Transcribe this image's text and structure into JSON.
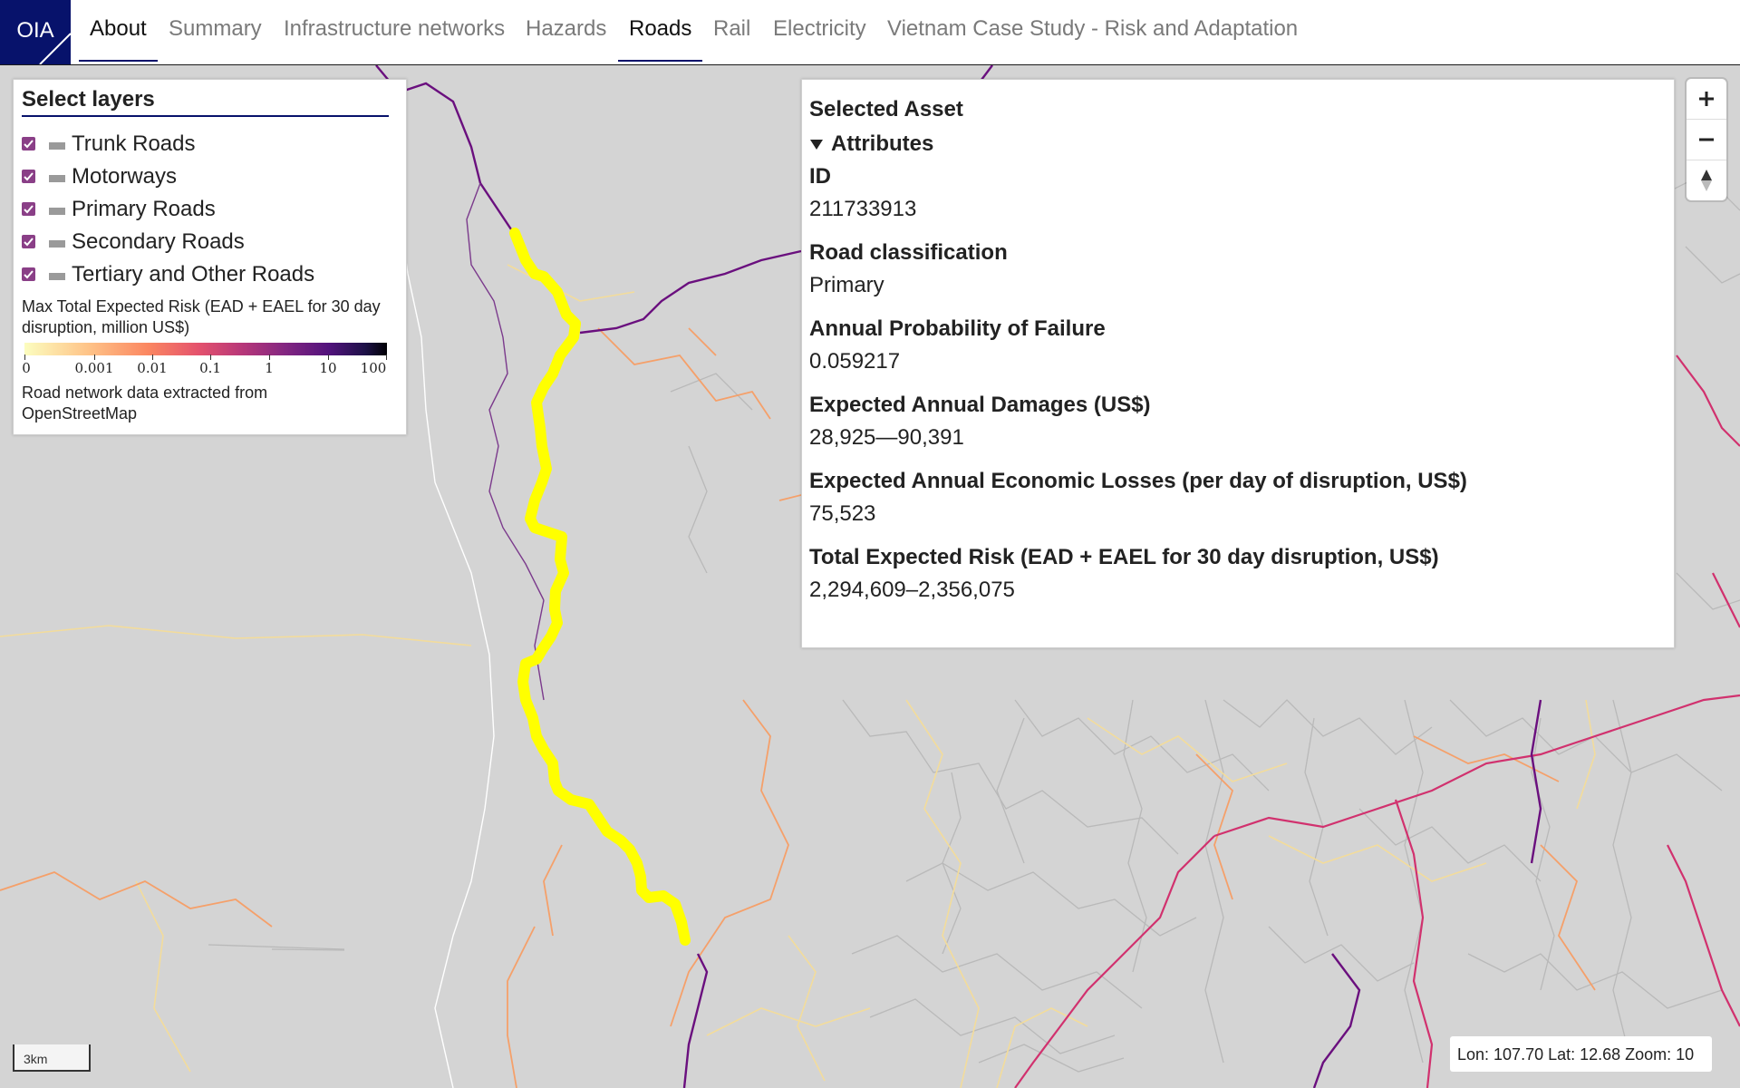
{
  "nav": {
    "logo_text": "OIA",
    "links": [
      "About",
      "Summary",
      "Infrastructure networks",
      "Hazards",
      "Roads",
      "Rail",
      "Electricity",
      "Vietnam Case Study - Risk and Adaptation"
    ],
    "active": [
      "About",
      "Roads"
    ]
  },
  "layers_panel": {
    "title": "Select layers",
    "layers": [
      {
        "label": "Trunk Roads",
        "checked": true
      },
      {
        "label": "Motorways",
        "checked": true
      },
      {
        "label": "Primary Roads",
        "checked": true
      },
      {
        "label": "Secondary Roads",
        "checked": true
      },
      {
        "label": "Tertiary and Other Roads",
        "checked": true
      }
    ],
    "legend": {
      "title": "Max Total Expected Risk (EAD + EAEL for 30 day disruption, million US$)",
      "tick_labels": [
        "0",
        "0.001",
        "0.01",
        "0.1",
        "1",
        "10",
        "100"
      ],
      "colors": [
        "#fcfdbf",
        "#fec287",
        "#fb8761",
        "#e4526d",
        "#b73779",
        "#822681",
        "#51127c",
        "#1d1147",
        "#000004"
      ],
      "note": "Road network data extracted from OpenStreetMap"
    }
  },
  "asset_panel": {
    "heading": "Selected Asset",
    "section": "Attributes",
    "fields": [
      {
        "label": "ID",
        "value": "211733913"
      },
      {
        "label": "Road classification",
        "value": "Primary"
      },
      {
        "label": "Annual Probability of Failure",
        "value": "0.059217"
      },
      {
        "label": "Expected Annual Damages (US$)",
        "value": "28,925—90,391"
      },
      {
        "label": "Expected Annual Economic Losses (per day of disruption, US$)",
        "value": "75,523"
      },
      {
        "label": "Total Expected Risk (EAD + EAEL for 30 day disruption, US$)",
        "value": "2,294,609–2,356,075"
      }
    ]
  },
  "map_controls": {
    "zoom_in": "zoom-in-icon",
    "zoom_out": "zoom-out-icon",
    "reset_bearing": "compass-icon"
  },
  "scale": "3km",
  "coordinates": "Lon: 107.70 Lat: 12.68 Zoom: 10",
  "map_colors": {
    "background": "#d4d4d4",
    "selected_road": "#ffff00",
    "minor_roads": "#b9b9b9",
    "high_risk": "#6a0f7e",
    "medium_risk": "#d1316e",
    "low_risk": "#f5a06a",
    "very_low_risk": "#f6df9f"
  }
}
